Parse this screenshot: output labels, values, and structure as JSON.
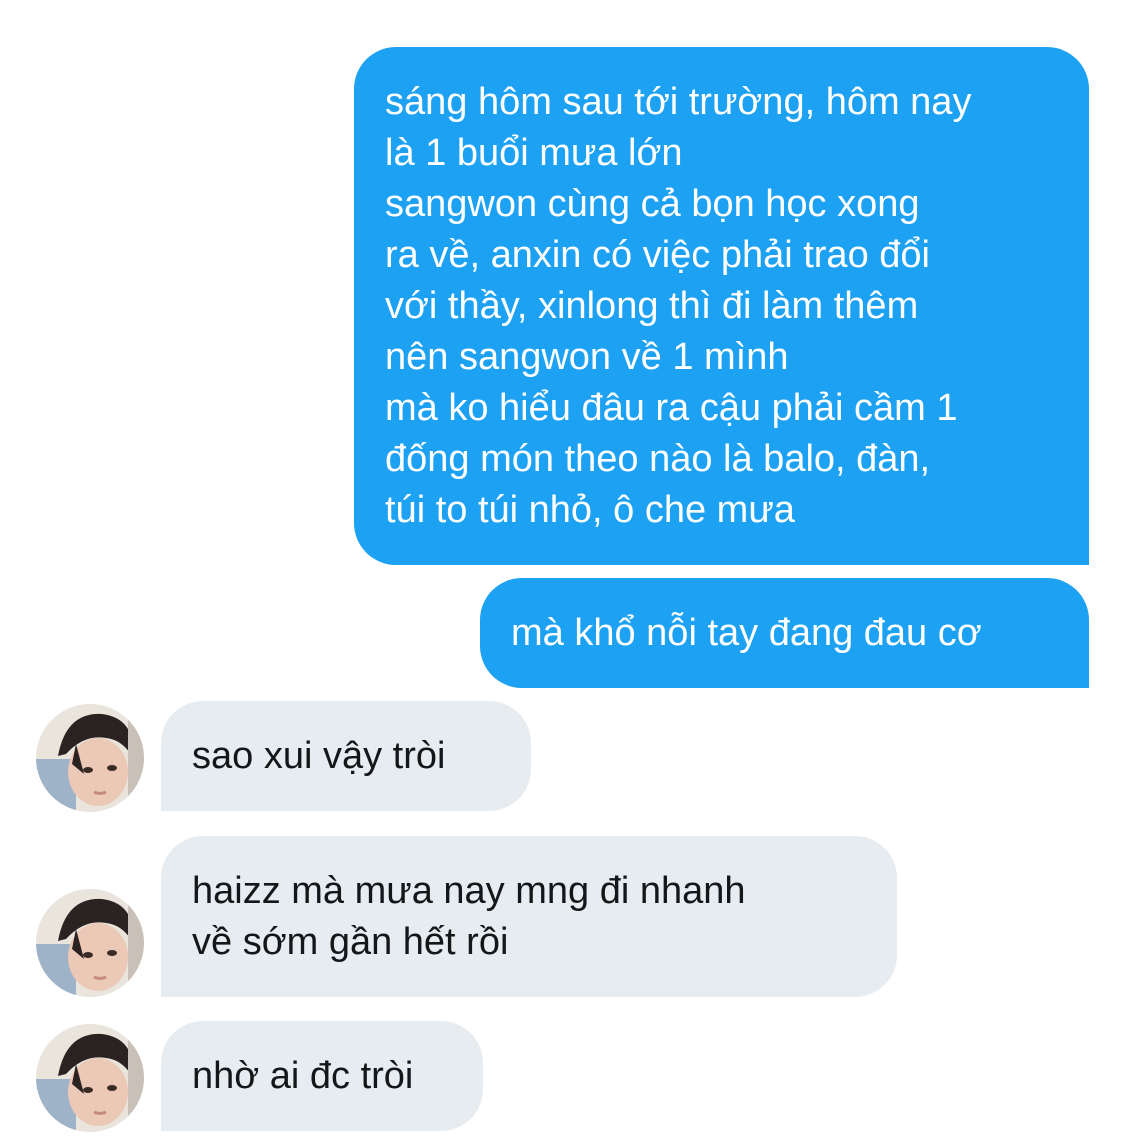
{
  "conversation": {
    "messages": [
      {
        "side": "sent",
        "text": "sáng hôm sau tới trường, hôm nay\nlà 1 buổi mưa lớn\nsangwon cùng cả bọn học xong\nra về, anxin có việc phải trao đổi\nvới thầy, xinlong thì đi làm thêm\nnên sangwon về 1 mình\nmà ko hiểu đâu ra cậu phải cầm 1\nđống món theo nào là balo, đàn,\ntúi to túi nhỏ, ô che mưa"
      },
      {
        "side": "sent",
        "text": "mà khổ nỗi tay đang đau cơ"
      },
      {
        "side": "received",
        "text": "sao xui vậy tròi",
        "avatar": "user-avatar"
      },
      {
        "side": "received",
        "text": "haizz mà mưa nay mng đi nhanh\nvề sớm gần hết rồi",
        "avatar": "user-avatar"
      },
      {
        "side": "received",
        "text": "nhờ ai đc tròi",
        "avatar": "user-avatar"
      }
    ]
  },
  "colors": {
    "sent_bubble": "#1da1f2",
    "sent_text": "#ffffff",
    "received_bubble": "#e6ecf0",
    "received_text": "#14171a",
    "background": "#ffffff"
  }
}
